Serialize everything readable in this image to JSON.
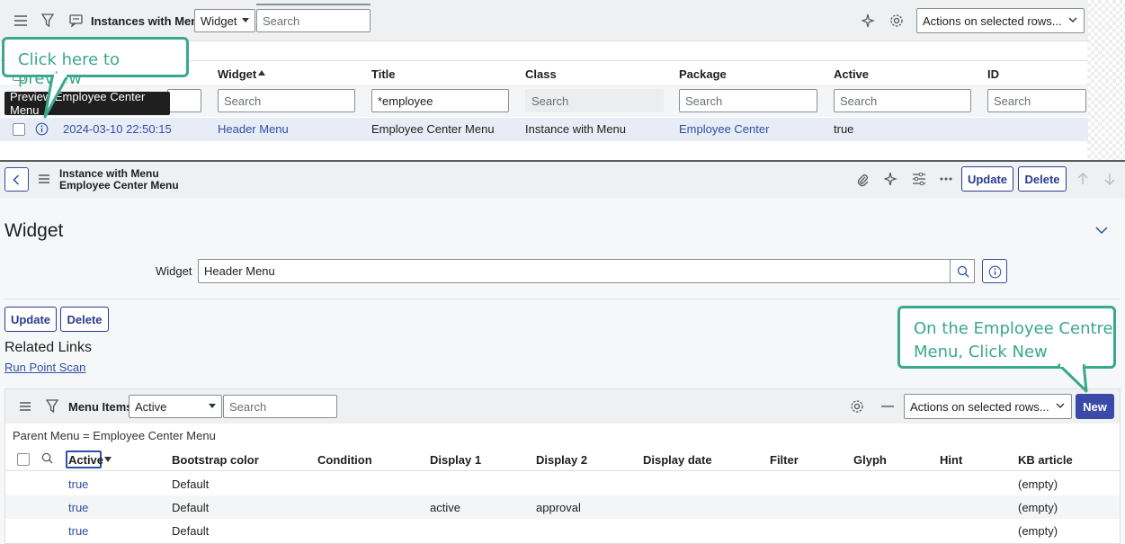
{
  "top_list": {
    "title": "Instances with Menu",
    "filter_field": "Widget",
    "search_placeholder": "Search",
    "actions_select": "Actions on selected rows...",
    "columns": [
      "Widget",
      "Title",
      "Class",
      "Package",
      "Active",
      "ID"
    ],
    "search_row": {
      "widget": "Search",
      "title": "*employee",
      "class": "Search",
      "package": "Search",
      "active": "Search",
      "id": "Search"
    },
    "row": {
      "updated": "2024-03-10 22:50:15",
      "widget": "Header Menu",
      "title": "Employee Center Menu",
      "class": "Instance with Menu",
      "package": "Employee Center",
      "active": "true"
    },
    "tooltip": "Preview Employee Center Menu"
  },
  "callouts": {
    "preview": "Click here to preview",
    "new_line1": "On the Employee Centre",
    "new_line2": "Menu, Click New"
  },
  "form_header": {
    "line1": "Instance with Menu",
    "line2": "Employee Center Menu",
    "update": "Update",
    "delete": "Delete"
  },
  "form": {
    "section_title": "Widget",
    "widget_label": "Widget",
    "widget_value": "Header Menu",
    "update": "Update",
    "delete": "Delete",
    "related_links_title": "Related Links",
    "run_point_scan": "Run Point Scan"
  },
  "related_list": {
    "title": "Menu Items",
    "filter_field": "Active",
    "search_placeholder": "Search",
    "actions_select": "Actions on selected rows...",
    "new_button": "New",
    "breadcrumb": "Parent Menu = Employee Center Menu",
    "columns": [
      "Active",
      "Bootstrap color",
      "Condition",
      "Display 1",
      "Display 2",
      "Display date",
      "Filter",
      "Glyph",
      "Hint",
      "KB article"
    ],
    "rows": [
      {
        "active": "true",
        "bootstrap": "Default",
        "display1": "",
        "display2": "",
        "kb": "(empty)"
      },
      {
        "active": "true",
        "bootstrap": "Default",
        "display1": "active",
        "display2": "approval",
        "kb": "(empty)"
      },
      {
        "active": "true",
        "bootstrap": "Default",
        "display1": "",
        "display2": "",
        "kb": "(empty)"
      }
    ]
  },
  "colors": {
    "accent": "#3b4aa8",
    "link": "#2e4fa3",
    "callout": "#3aa88a"
  }
}
